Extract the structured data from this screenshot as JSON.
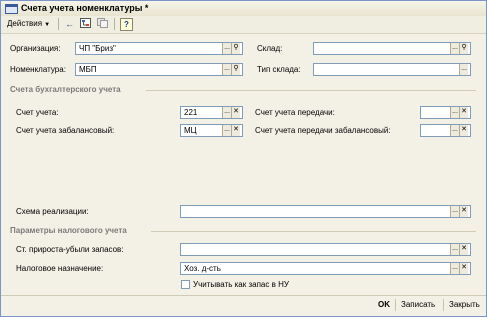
{
  "window": {
    "title": "Счета учета номенклатуры *"
  },
  "toolbar": {
    "actions_label": "Действия",
    "help_label": "?"
  },
  "header": {
    "org_label": "Организация:",
    "org_value": "ЧП \"Бриз\"",
    "item_label": "Номенклатура:",
    "item_value": "МБП",
    "warehouse_label": "Склад:",
    "warehouse_value": "",
    "warehouse_type_label": "Тип склада:",
    "warehouse_type_value": ""
  },
  "accounting": {
    "section_title": "Счета бухгалтерского учета",
    "account_label": "Счет учета:",
    "account_value": "221",
    "offbalance_label": "Счет учета забалансовый:",
    "offbalance_value": "МЦ",
    "transfer_label": "Счет учета передачи:",
    "transfer_value": "",
    "transfer_offbalance_label": "Счет учета передачи забалансовый:",
    "transfer_offbalance_value": "",
    "sales_scheme_label": "Схема реализации:",
    "sales_scheme_value": ""
  },
  "tax": {
    "section_title": "Параметры налогового учета",
    "gain_loss_label": "Ст. прироста-убыли запасов:",
    "gain_loss_value": "",
    "purpose_label": "Налоговое назначение:",
    "purpose_value": "Хоз. д-сть",
    "inventory_checkbox_label": "Учитывать как запас в НУ"
  },
  "footer": {
    "ok_label": "OK",
    "save_label": "Записать",
    "close_label": "Закрыть"
  }
}
